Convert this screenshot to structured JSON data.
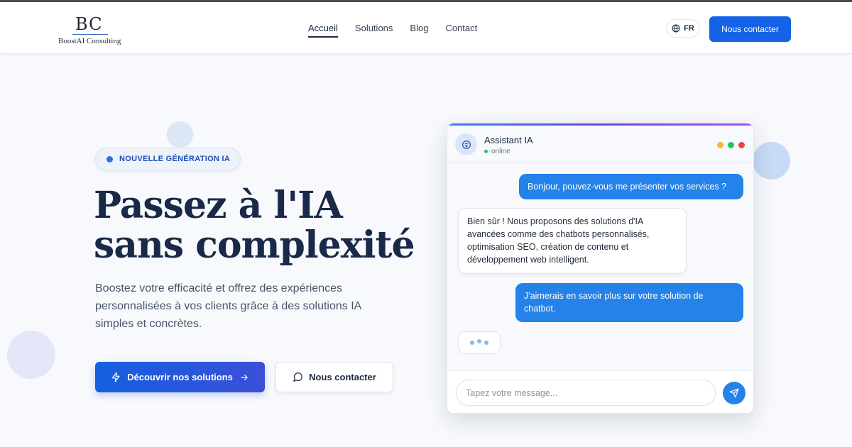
{
  "brand": {
    "mark": "BC",
    "name": "BoostAI Consulting"
  },
  "nav": {
    "items": [
      {
        "label": "Accueil",
        "active": true
      },
      {
        "label": "Solutions",
        "active": false
      },
      {
        "label": "Blog",
        "active": false
      },
      {
        "label": "Contact",
        "active": false
      }
    ],
    "language": "FR",
    "cta_label": "Nous contacter"
  },
  "hero": {
    "badge": "NOUVELLE GÉNÉRATION IA",
    "title_line1": "Passez à l'IA",
    "title_line2": "sans complexité",
    "lead": "Boostez votre efficacité et offrez des expériences personnalisées à vos clients grâce à des solutions IA simples et concrètes.",
    "primary_cta": "Découvrir nos solutions",
    "secondary_cta": "Nous contacter"
  },
  "chat": {
    "assistant_name": "Assistant IA",
    "status": "online",
    "messages": [
      {
        "from": "user",
        "text": "Bonjour, pouvez-vous me présenter vos services ?"
      },
      {
        "from": "bot",
        "text": "Bien sûr ! Nous proposons des solutions d'IA avancées comme des chatbots personnalisés, optimisation SEO, création de contenu et développement web intelligent."
      },
      {
        "from": "user",
        "text": "J'aimerais en savoir plus sur votre solution de chatbot."
      }
    ],
    "input_placeholder": "Tapez votre message..."
  },
  "colors": {
    "primary": "#1463e6",
    "heading": "#1a2947",
    "user_bubble": "#2482e8",
    "dot_yellow": "#f5b82e",
    "dot_green": "#22c55e",
    "dot_red": "#ef4444"
  }
}
